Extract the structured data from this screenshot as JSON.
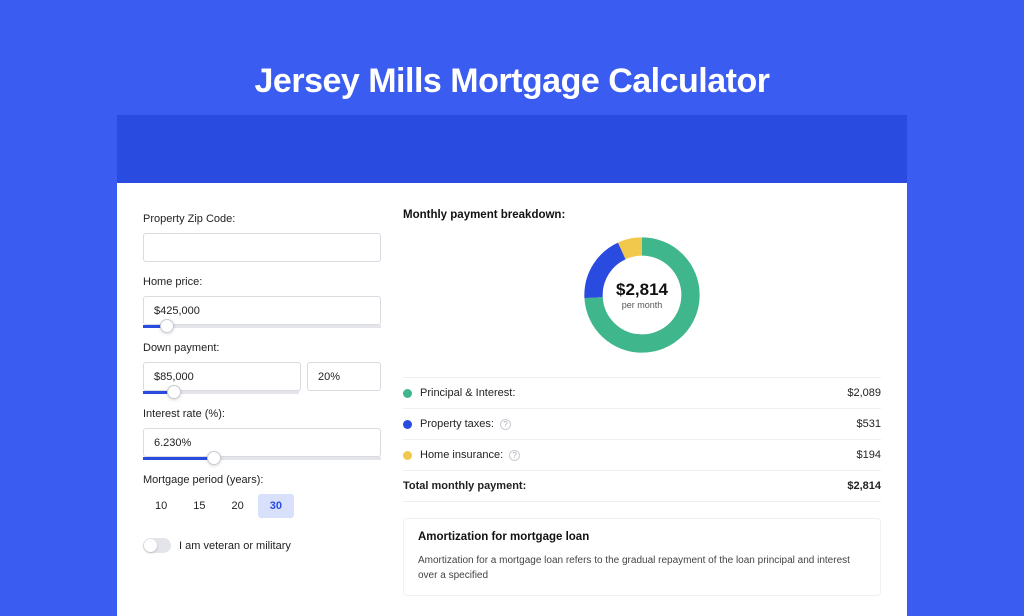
{
  "page": {
    "title": "Jersey Mills Mortgage Calculator"
  },
  "form": {
    "zip_label": "Property Zip Code:",
    "zip_value": "",
    "price_label": "Home price:",
    "price_value": "$425,000",
    "price_slider_pct": 10,
    "down_label": "Down payment:",
    "down_value": "$85,000",
    "down_pct": "20%",
    "down_slider_pct": 20,
    "rate_label": "Interest rate (%):",
    "rate_value": "6.230%",
    "rate_slider_pct": 30,
    "period_label": "Mortgage period (years):",
    "periods": [
      "10",
      "15",
      "20",
      "30"
    ],
    "period_active": "30",
    "veteran_label": "I am veteran or military",
    "veteran_on": false
  },
  "breakdown": {
    "heading": "Monthly payment breakdown:",
    "total_amount": "$2,814",
    "total_sub": "per month",
    "items": [
      {
        "key": "pi",
        "label": "Principal & Interest:",
        "value": "$2,089",
        "color": "#3fb68b",
        "pct": 74,
        "info": false
      },
      {
        "key": "tax",
        "label": "Property taxes:",
        "value": "$531",
        "color": "#2a4be0",
        "pct": 19,
        "info": true
      },
      {
        "key": "ins",
        "label": "Home insurance:",
        "value": "$194",
        "color": "#f1c84c",
        "pct": 7,
        "info": true
      }
    ],
    "total_row_label": "Total monthly payment:",
    "total_row_value": "$2,814"
  },
  "amort": {
    "heading": "Amortization for mortgage loan",
    "body": "Amortization for a mortgage loan refers to the gradual repayment of the loan principal and interest over a specified"
  },
  "chart_data": {
    "type": "pie",
    "title": "Monthly payment breakdown",
    "series": [
      {
        "name": "Principal & Interest",
        "value": 2089,
        "color": "#3fb68b"
      },
      {
        "name": "Property taxes",
        "value": 531,
        "color": "#2a4be0"
      },
      {
        "name": "Home insurance",
        "value": 194,
        "color": "#f1c84c"
      }
    ],
    "total": 2814,
    "center_label": "$2,814 per month"
  }
}
